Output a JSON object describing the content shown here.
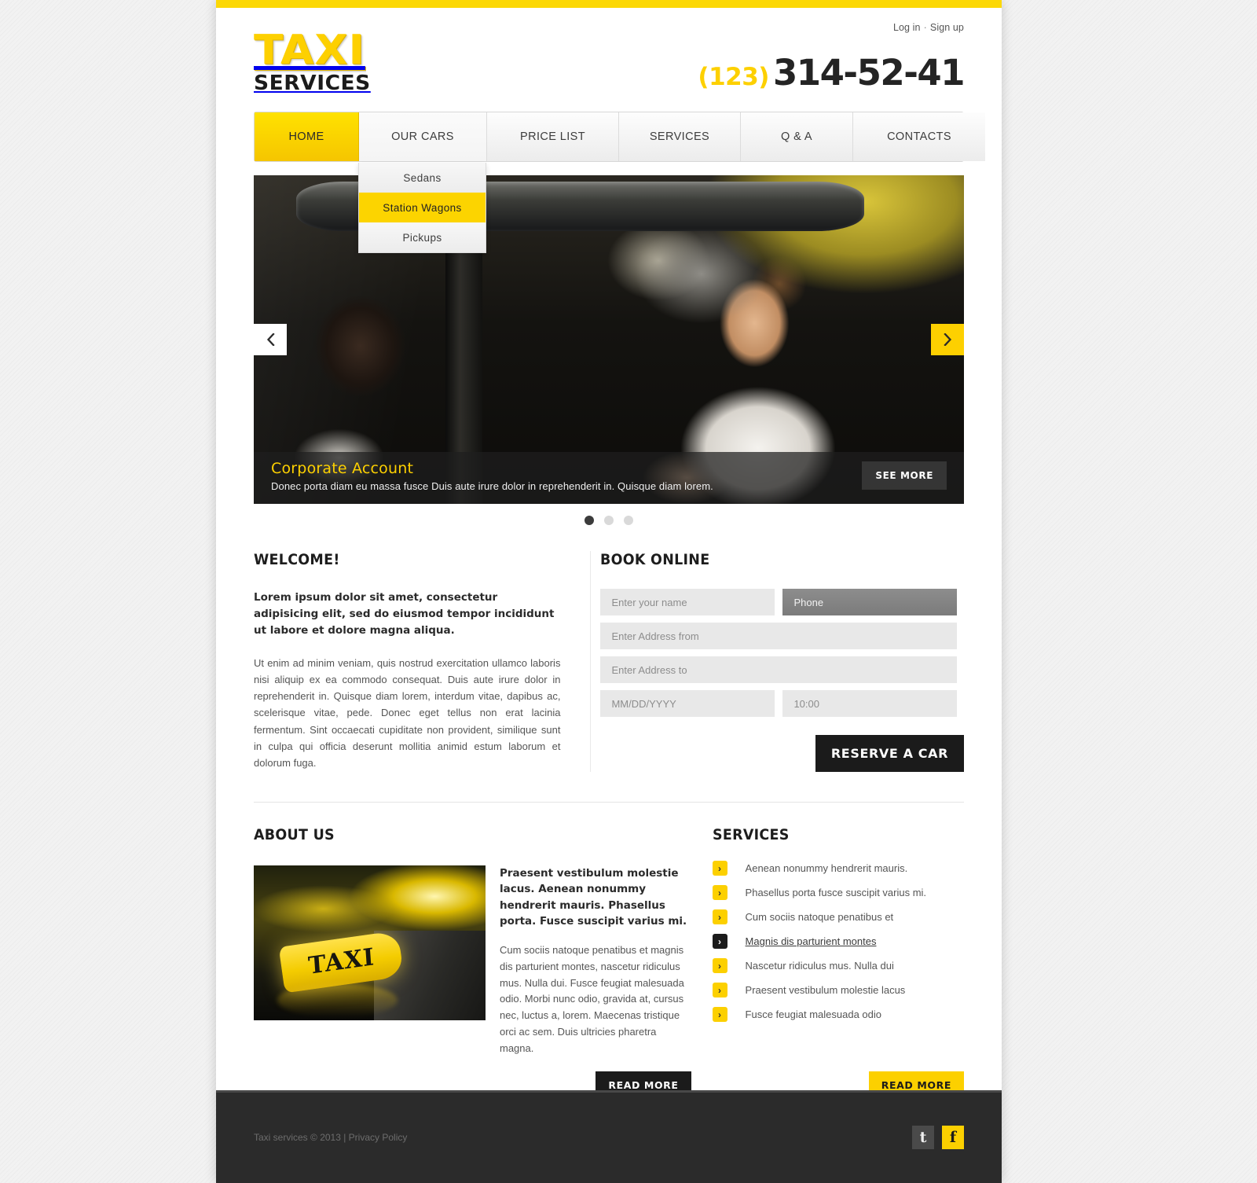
{
  "header": {
    "auth": {
      "login": "Log in",
      "separator": "·",
      "signup": "Sign up"
    },
    "logo": {
      "line1": "TAXI",
      "line2": "SERVICES"
    },
    "phone": {
      "code": "(123)",
      "number": "314-52-41"
    }
  },
  "nav": {
    "items": [
      {
        "label": "HOME",
        "state": "active"
      },
      {
        "label": "OUR CARS",
        "state": "open"
      },
      {
        "label": "PRICE LIST",
        "state": "normal"
      },
      {
        "label": "SERVICES",
        "state": "normal"
      },
      {
        "label": "Q & A",
        "state": "normal"
      },
      {
        "label": "CONTACTS",
        "state": "normal"
      }
    ],
    "dropdown": [
      {
        "label": "Sedans",
        "state": "normal"
      },
      {
        "label": "Station Wagons",
        "state": "highlighted"
      },
      {
        "label": "Pickups",
        "state": "normal"
      }
    ]
  },
  "slider": {
    "title": "Corporate Account",
    "description": "Donec porta diam eu massa fusce  Duis aute irure dolor in reprehenderit in. Quisque diam lorem.",
    "see_more_label": "SEE MORE",
    "prev_icon": "chevron-left",
    "next_icon": "chevron-right",
    "dots": [
      true,
      false,
      false
    ]
  },
  "welcome": {
    "heading": "WELCOME!",
    "lead": "Lorem ipsum dolor sit amet, consectetur adipisicing elit, sed do eiusmod tempor incididunt ut labore et dolore magna aliqua.",
    "body": "Ut enim ad minim veniam, quis nostrud exercitation ullamco laboris nisi aliquip ex ea commodo consequat. Duis aute irure dolor in reprehenderit in. Quisque diam lorem, interdum vitae, dapibus ac, scelerisque vitae, pede. Donec eget tellus non erat lacinia fermentum. Sint occaecati cupiditate non provident, similique sunt in culpa qui officia deserunt mollitia animid estum laborum et dolorum fuga."
  },
  "book": {
    "heading": "BOOK ONLINE",
    "fields": {
      "name": {
        "placeholder": "Enter your name",
        "value": ""
      },
      "phone": {
        "placeholder": "Phone",
        "value": ""
      },
      "address_from": {
        "placeholder": "Enter Address from",
        "value": ""
      },
      "address_to": {
        "placeholder": "Enter Address to",
        "value": ""
      },
      "date": {
        "placeholder": "MM/DD/YYYY",
        "value": ""
      },
      "time": {
        "placeholder": "10:00",
        "value": ""
      }
    },
    "submit_label": "RESERVE A CAR"
  },
  "about": {
    "heading": "ABOUT US",
    "photo_caption": "TAXI",
    "lead": "Praesent vestibulum molestie lacus. Aenean nonummy hendrerit mauris. Phasellus porta. Fusce suscipit varius mi.",
    "body": "Cum sociis natoque penatibus et magnis dis parturient montes, nascetur ridiculus mus. Nulla dui. Fusce feugiat malesuada odio. Morbi nunc odio, gravida at, cursus nec, luctus a, lorem. Maecenas tristique orci ac sem. Duis ultricies pharetra magna.",
    "read_more_label": "READ MORE"
  },
  "services": {
    "heading": "SERVICES",
    "items": [
      {
        "label": "Aenean nonummy hendrerit mauris.",
        "state": "normal"
      },
      {
        "label": "Phasellus porta fusce suscipit varius mi.",
        "state": "normal"
      },
      {
        "label": "Cum sociis natoque penatibus et",
        "state": "normal"
      },
      {
        "label": "Magnis dis parturient montes ",
        "state": "hover"
      },
      {
        "label": "Nascetur ridiculus mus. Nulla dui",
        "state": "normal"
      },
      {
        "label": "Praesent vestibulum molestie lacus",
        "state": "normal"
      },
      {
        "label": "Fusce feugiat malesuada odio",
        "state": "normal"
      }
    ],
    "read_more_label": "READ MORE"
  },
  "footer": {
    "copyright": "Taxi services © 2013 | Privacy Policy",
    "socials": [
      {
        "name": "twitter-icon",
        "glyph": "t"
      },
      {
        "name": "facebook-icon",
        "glyph": "f"
      }
    ]
  },
  "colors": {
    "brand_yellow": "#fcd000",
    "dark": "#1b1b1b",
    "footer_bg": "#2b2b2b"
  }
}
